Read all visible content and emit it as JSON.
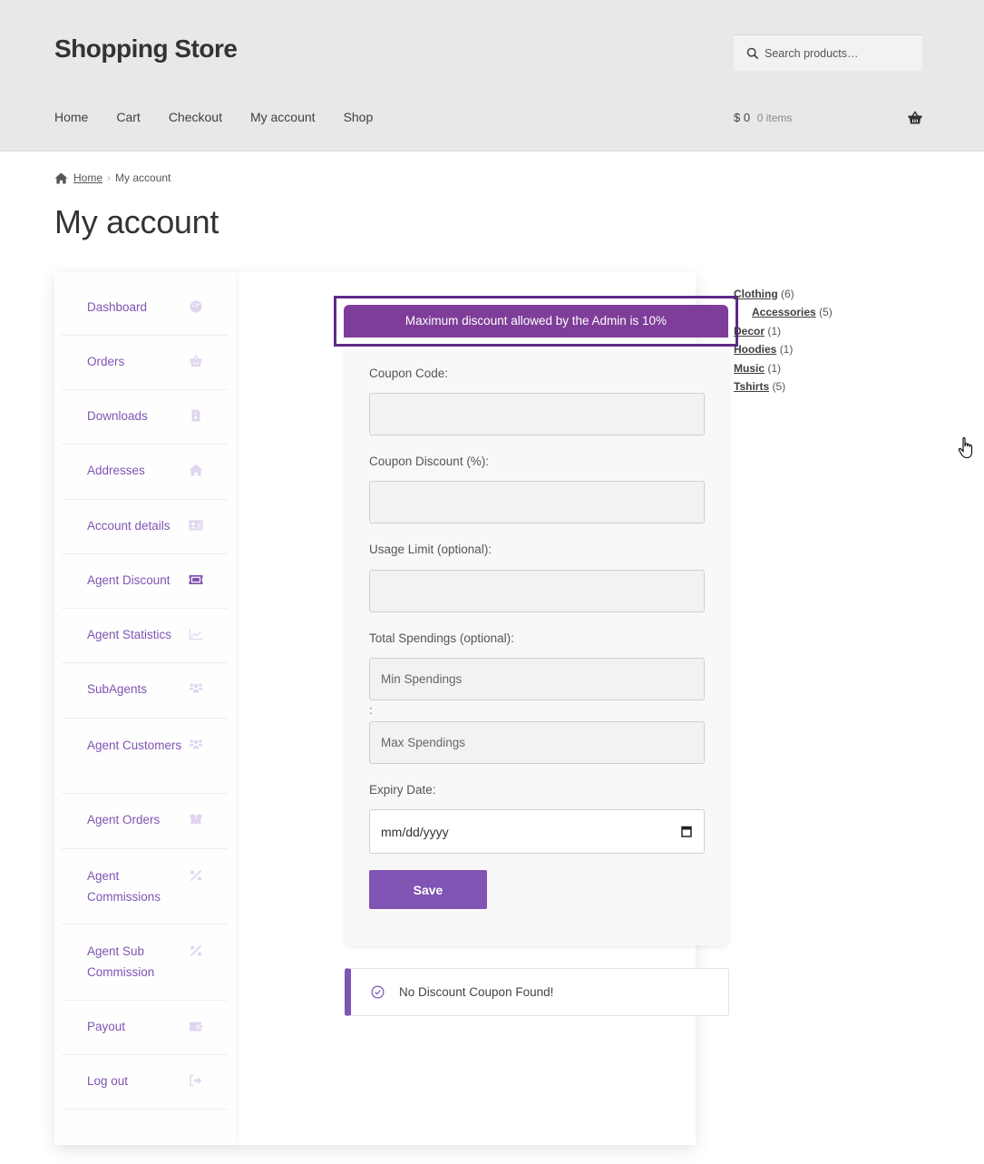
{
  "header": {
    "site_title": "Shopping Store",
    "search_placeholder": "Search products…",
    "nav": [
      "Home",
      "Cart",
      "Checkout",
      "My account",
      "Shop"
    ],
    "cart_amount": "$ 0",
    "cart_items": "0 items"
  },
  "breadcrumb": {
    "home": "Home",
    "separator": "›",
    "current": "My account"
  },
  "page_title": "My account",
  "account_nav": {
    "active_color": "#7f54b3",
    "icon_color": "#e0d5ee",
    "items": [
      {
        "label": "Dashboard",
        "icon": "dashboard-icon"
      },
      {
        "label": "Orders",
        "icon": "basket-icon"
      },
      {
        "label": "Downloads",
        "icon": "file-download-icon"
      },
      {
        "label": "Addresses",
        "icon": "home-icon"
      },
      {
        "label": "Account details",
        "icon": "id-card-icon"
      },
      {
        "label": "Agent Discount",
        "icon": "ticket-icon",
        "active": true
      },
      {
        "label": "Agent Statistics",
        "icon": "chart-line-icon"
      },
      {
        "label": "SubAgents",
        "icon": "users-icon"
      },
      {
        "label": "Agent Customers",
        "icon": "users-icon"
      },
      {
        "label": "Agent Orders",
        "icon": "box-open-icon"
      },
      {
        "label": "Agent Commissions",
        "icon": "percent-icon"
      },
      {
        "label": "Agent Sub Commission",
        "icon": "percent-icon"
      },
      {
        "label": "Payout",
        "icon": "wallet-icon"
      },
      {
        "label": "Log out",
        "icon": "sign-out-icon"
      }
    ]
  },
  "discount_form": {
    "notice": "Maximum discount allowed by the Admin is 10%",
    "coupon_code_label": "Coupon Code:",
    "coupon_code_value": "",
    "coupon_discount_label": "Coupon Discount (%):",
    "coupon_discount_value": "",
    "usage_limit_label": "Usage Limit (optional):",
    "usage_limit_value": "",
    "total_spendings_label": "Total Spendings (optional):",
    "min_spendings_placeholder": "Min Spendings",
    "spendings_separator": ":",
    "max_spendings_placeholder": "Max Spendings",
    "expiry_label": "Expiry Date:",
    "expiry_placeholder": "mm/dd/yyyy",
    "save_label": "Save"
  },
  "info_notice": "No Discount Coupon Found!",
  "categories": [
    {
      "name": "Clothing",
      "count": "(6)",
      "child": false
    },
    {
      "name": "Accessories",
      "count": "(5)",
      "child": true
    },
    {
      "name": "Decor",
      "count": "(1)",
      "child": false
    },
    {
      "name": "Hoodies",
      "count": "(1)",
      "child": false
    },
    {
      "name": "Music",
      "count": "(1)",
      "child": false
    },
    {
      "name": "Tshirts",
      "count": "(5)",
      "child": false
    }
  ],
  "colors": {
    "brand_purple": "#7f54b3",
    "notice_purple": "#7e3d98",
    "notice_border": "#5e2a8a",
    "header_bg": "#e8e8e8"
  }
}
